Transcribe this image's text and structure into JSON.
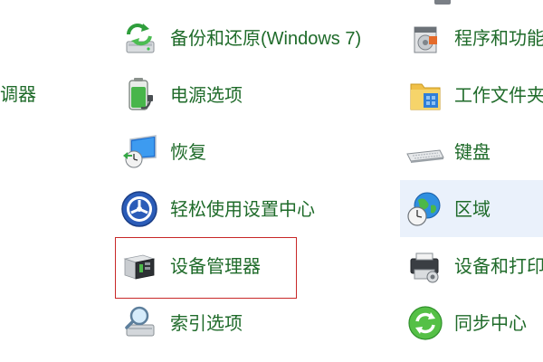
{
  "left_column": {
    "partial_item_label": "调器"
  },
  "middle_column": {
    "items": [
      {
        "label": "备份和还原(Windows 7)",
        "icon": "backup-restore-icon"
      },
      {
        "label": "电源选项",
        "icon": "battery-power-icon"
      },
      {
        "label": "恢复",
        "icon": "recovery-monitor-icon"
      },
      {
        "label": "轻松使用设置中心",
        "icon": "ease-of-access-icon"
      },
      {
        "label": "设备管理器",
        "icon": "device-manager-icon"
      },
      {
        "label": "索引选项",
        "icon": "indexing-options-icon"
      }
    ]
  },
  "right_column": {
    "items": [
      {
        "label": "程序和功能",
        "icon": "programs-features-icon"
      },
      {
        "label": "工作文件夹",
        "icon": "work-folders-icon"
      },
      {
        "label": "键盘",
        "icon": "keyboard-icon"
      },
      {
        "label": "区域",
        "icon": "region-globe-icon"
      },
      {
        "label": "设备和打印机",
        "icon": "devices-printers-icon"
      },
      {
        "label": "同步中心",
        "icon": "sync-center-icon"
      }
    ]
  },
  "colors": {
    "link_text": "#1f6b2a",
    "highlight_border": "#c82828",
    "hover_background": "#eaf1fb"
  }
}
